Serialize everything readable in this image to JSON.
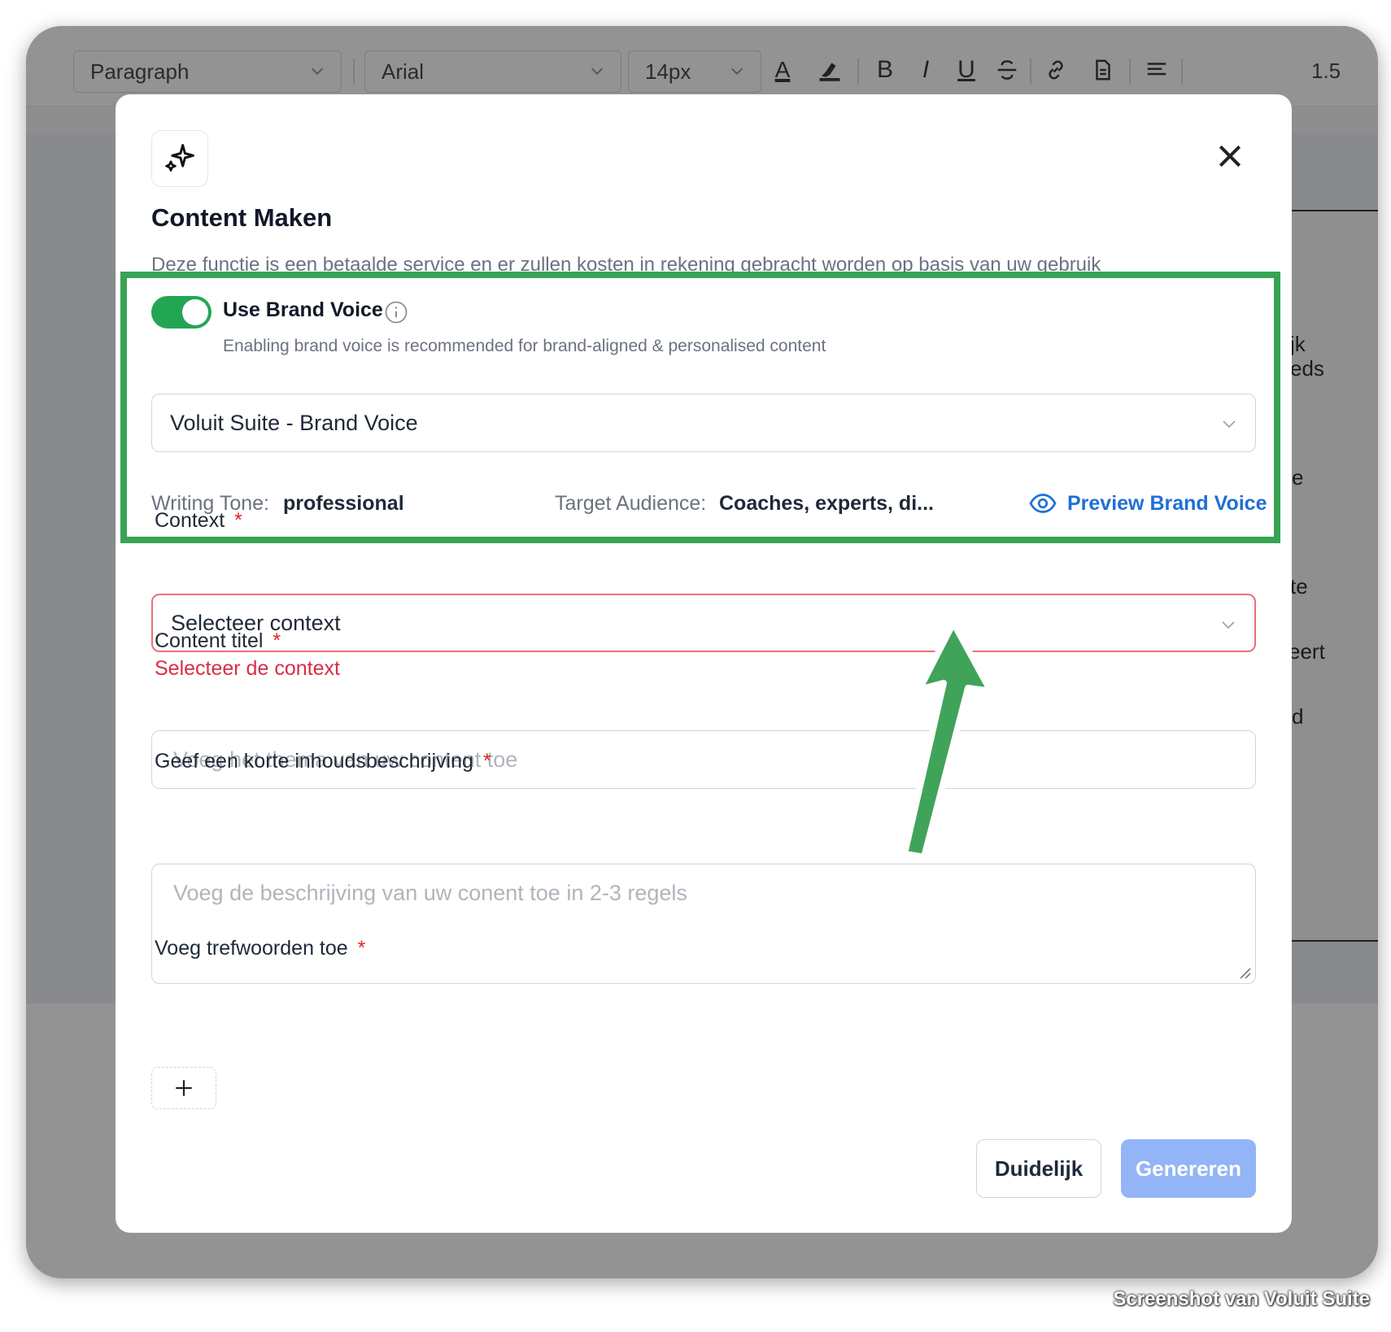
{
  "toolbar": {
    "block_format": "Paragraph",
    "font_family": "Arial",
    "font_size": "14px",
    "line_height": "1.5",
    "icons": [
      "text-color-icon",
      "highlight-icon",
      "bold-icon",
      "italic-icon",
      "underline-icon",
      "strikethrough-icon",
      "link-icon",
      "document-icon",
      "align-left-icon"
    ],
    "bold_glyph": "B",
    "italic_glyph": "I",
    "underline_glyph": "U",
    "text_color_glyph": "A"
  },
  "background_peek": [
    "jk",
    "eds",
    "e",
    "te",
    "eert",
    "d"
  ],
  "modal": {
    "title": "Content Maken",
    "description": "Deze functie is een betaalde service en er zullen kosten in rekening gebracht worden op basis van uw gebruik",
    "icon": "sparkles-icon",
    "brand_voice": {
      "enabled": true,
      "label": "Use Brand Voice",
      "help": "Enabling brand voice is recommended for brand-aligned & personalised content",
      "selected": "Voluit Suite - Brand Voice",
      "writing_tone_label": "Writing Tone:",
      "writing_tone_value": "professional",
      "target_audience_label": "Target Audience:",
      "target_audience_value": "Coaches, experts, di...",
      "preview_label": "Preview Brand Voice"
    },
    "context": {
      "label": "Context",
      "required_mark": "*",
      "placeholder": "Selecteer context",
      "error": "Selecteer de context"
    },
    "content_title": {
      "label": "Content titel",
      "required_mark": "*",
      "placeholder": "Voeg het thema van uw content toe"
    },
    "description_field": {
      "label": "Geef een korte inhoudsbeschrijving",
      "required_mark": "*",
      "placeholder": "Voeg de beschrijving van uw conent toe in 2-3 regels"
    },
    "keywords": {
      "label": "Voeg trefwoorden toe",
      "required_mark": "*"
    },
    "buttons": {
      "clear": "Duidelijk",
      "generate": "Genereren"
    }
  },
  "colors": {
    "accent_green": "#22a654",
    "highlight_green": "#38a352",
    "link_blue": "#1f6fd6",
    "error_red": "#d92d45",
    "generate_disabled": "#93b4f7"
  },
  "watermark": "Screenshot van Voluit Suite"
}
